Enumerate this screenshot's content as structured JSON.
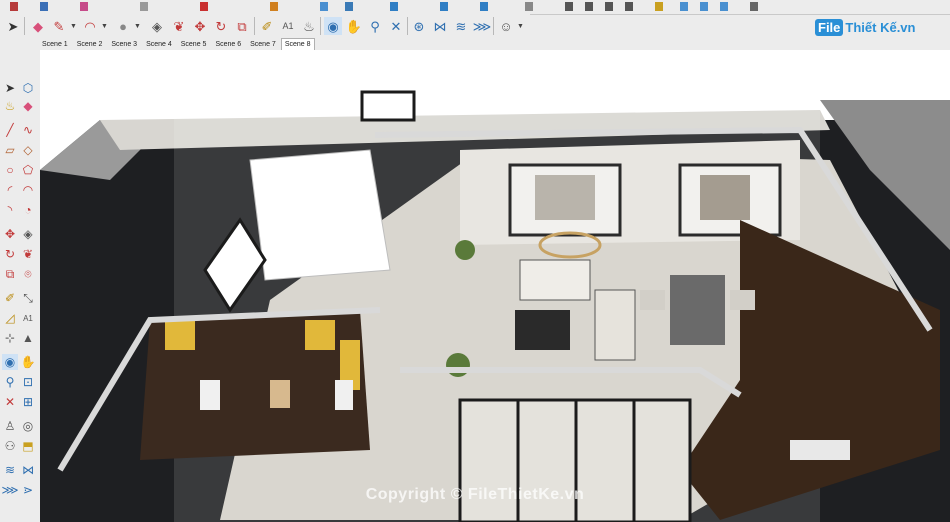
{
  "scenes": {
    "tabs": [
      "Scene 1",
      "Scene 2",
      "Scene 3",
      "Scene 4",
      "Scene 5",
      "Scene 6",
      "Scene 7",
      "Scene 8"
    ],
    "active": "Scene 8"
  },
  "logo": {
    "mark": "File",
    "text": "Thiết Kế.vn"
  },
  "watermark": "Copyright © FileThietKe.vn",
  "viewport": {
    "description_icons": [
      "select-icon",
      "eraser-icon",
      "pencil-icon",
      "arc-icon",
      "push-pull-icon",
      "move-icon",
      "rotate-icon",
      "scale-icon",
      "offset-icon",
      "tape-measure-icon",
      "text-icon",
      "paint-bucket-icon",
      "orbit-icon",
      "pan-icon",
      "zoom-icon",
      "zoom-extents-icon",
      "walk-icon",
      "look-around-icon",
      "section-plane-icon"
    ]
  },
  "colors": {
    "accent": "#2a8fd6",
    "toolbar_bg": "#ececec",
    "floor_dark": "#1d1d1f",
    "wood": "#3e2a1e",
    "wall": "#e6e4de"
  }
}
